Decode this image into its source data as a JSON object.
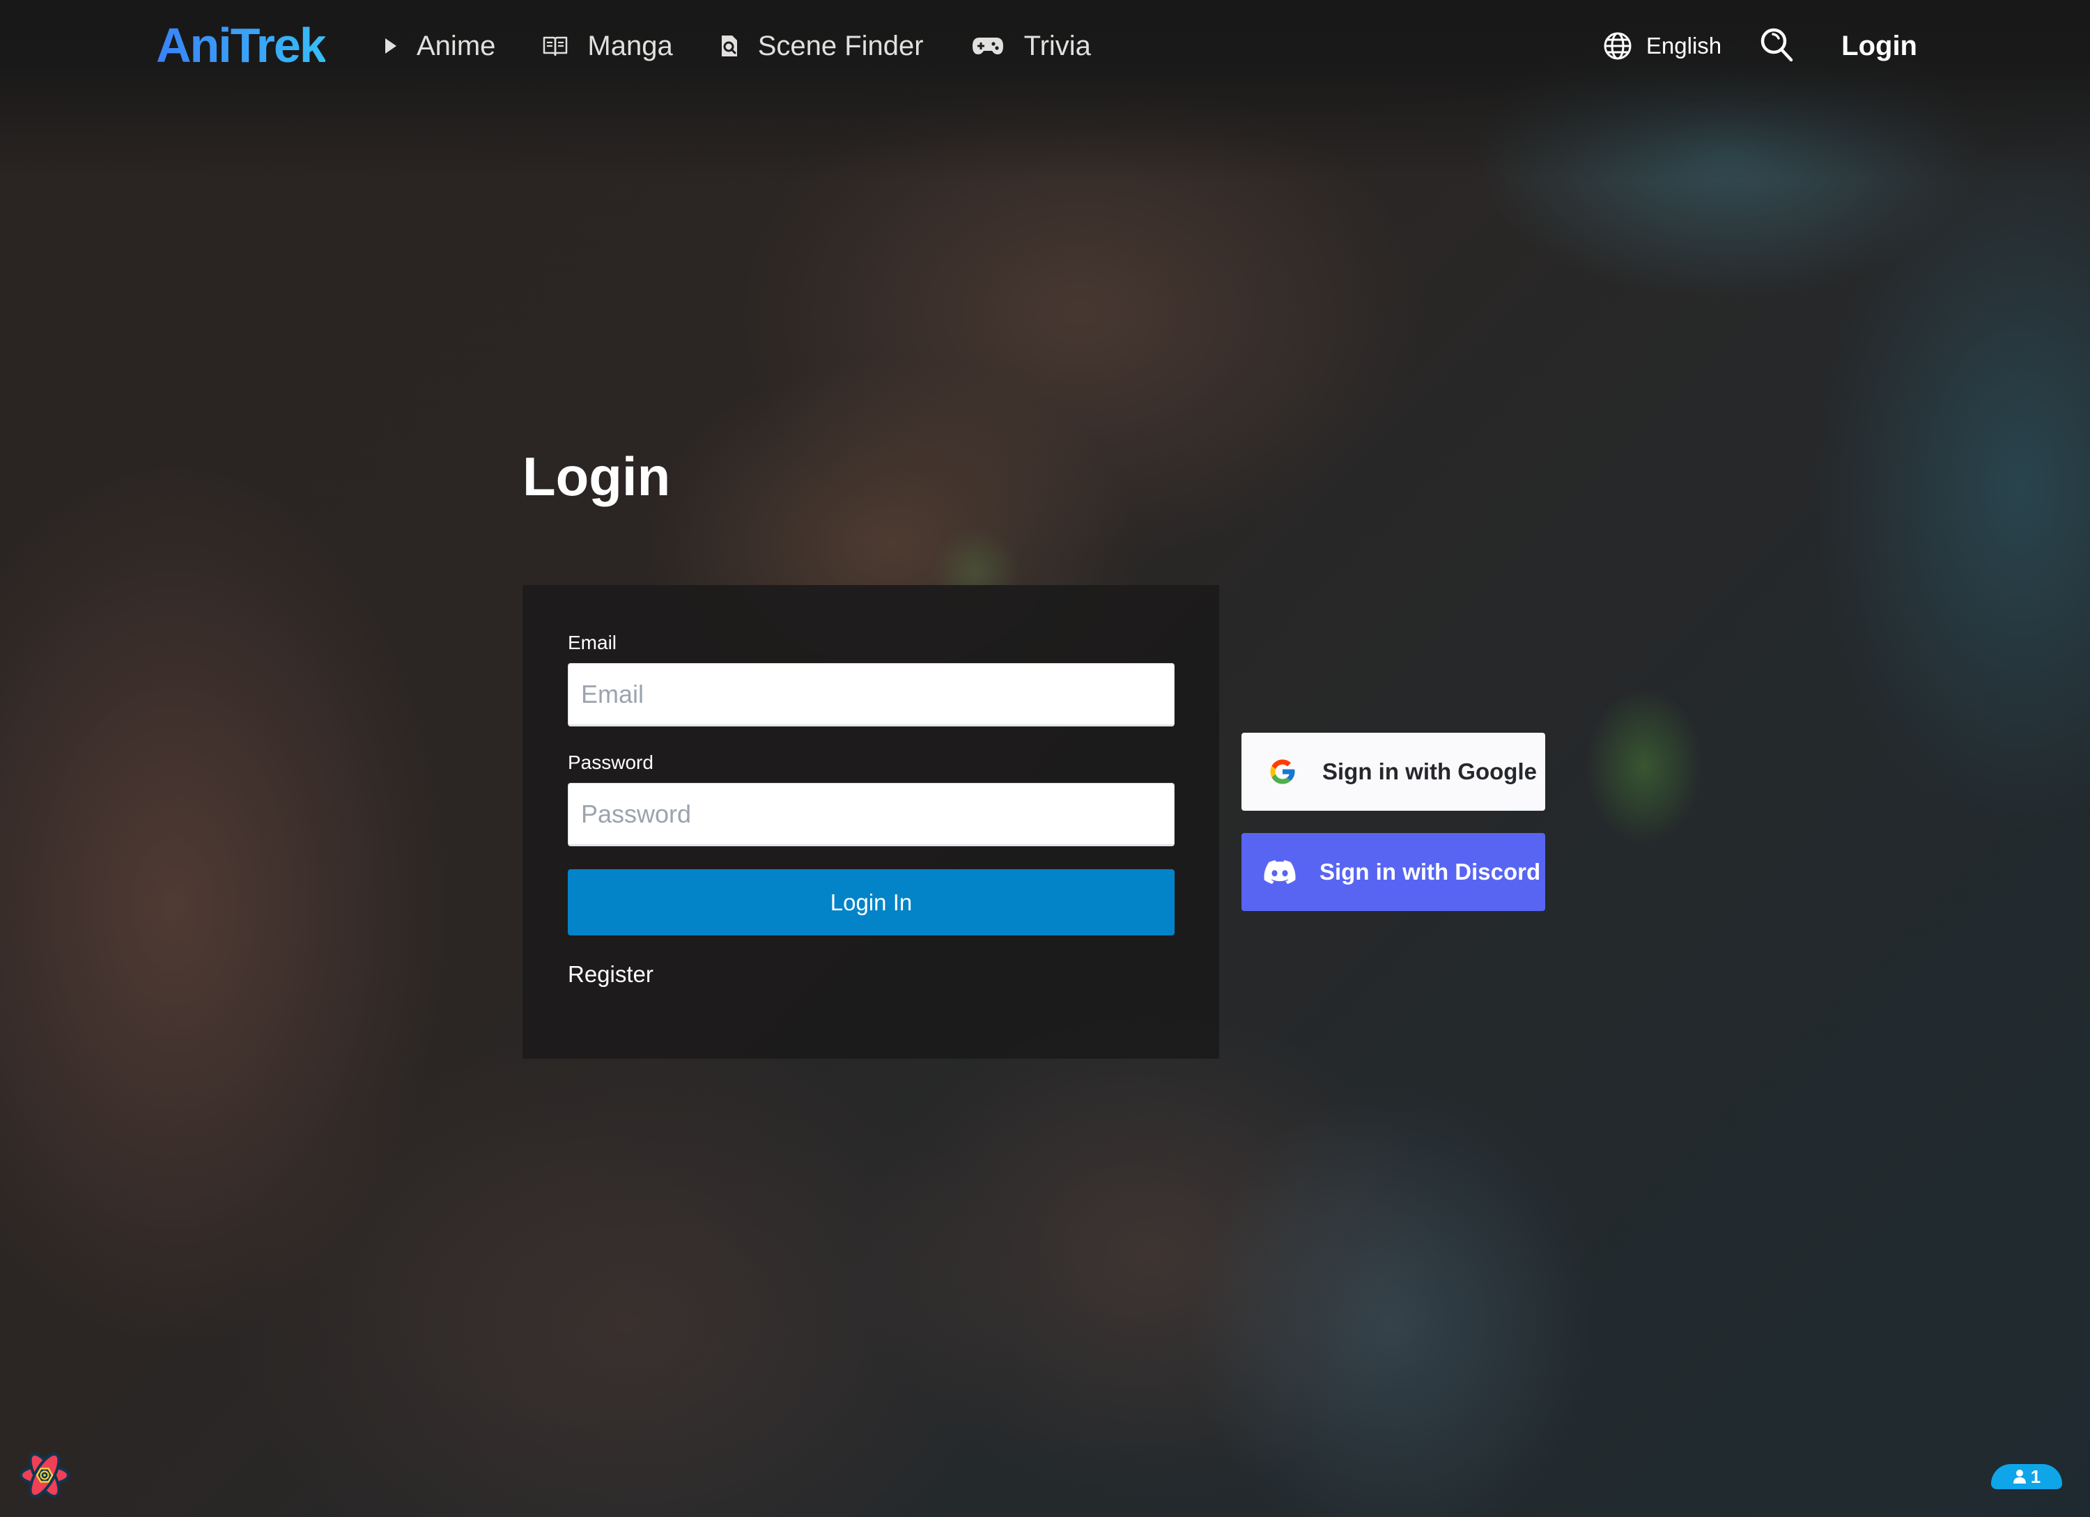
{
  "header": {
    "logo": "AniTrek",
    "nav": [
      {
        "label": "Anime",
        "icon": "play-icon"
      },
      {
        "label": "Manga",
        "icon": "book-icon"
      },
      {
        "label": "Scene Finder",
        "icon": "file-search-icon"
      },
      {
        "label": "Trivia",
        "icon": "gamepad-icon"
      }
    ],
    "language": {
      "label": "English",
      "icon": "globe-icon"
    },
    "search_icon": "search-icon",
    "login_label": "Login"
  },
  "main": {
    "title": "Login",
    "form": {
      "email_label": "Email",
      "email_value": "",
      "email_placeholder": "Email",
      "password_label": "Password",
      "password_value": "",
      "password_placeholder": "Password",
      "submit_label": "Login In",
      "register_label": "Register"
    },
    "social": {
      "google_label": "Sign in with Google",
      "discord_label": "Sign in with Discord"
    }
  },
  "widgets": {
    "devtools_icon": "react-query-devtools-icon",
    "presence_count": "1",
    "presence_icon": "user-icon"
  },
  "colors": {
    "logo_gradient_start": "#3b82f6",
    "logo_gradient_end": "#38bdf8",
    "primary_button": "#0384c8",
    "google_button_bg": "#fafafd",
    "discord_button_bg": "#5865f2",
    "presence_badge": "#0ea5e9"
  }
}
